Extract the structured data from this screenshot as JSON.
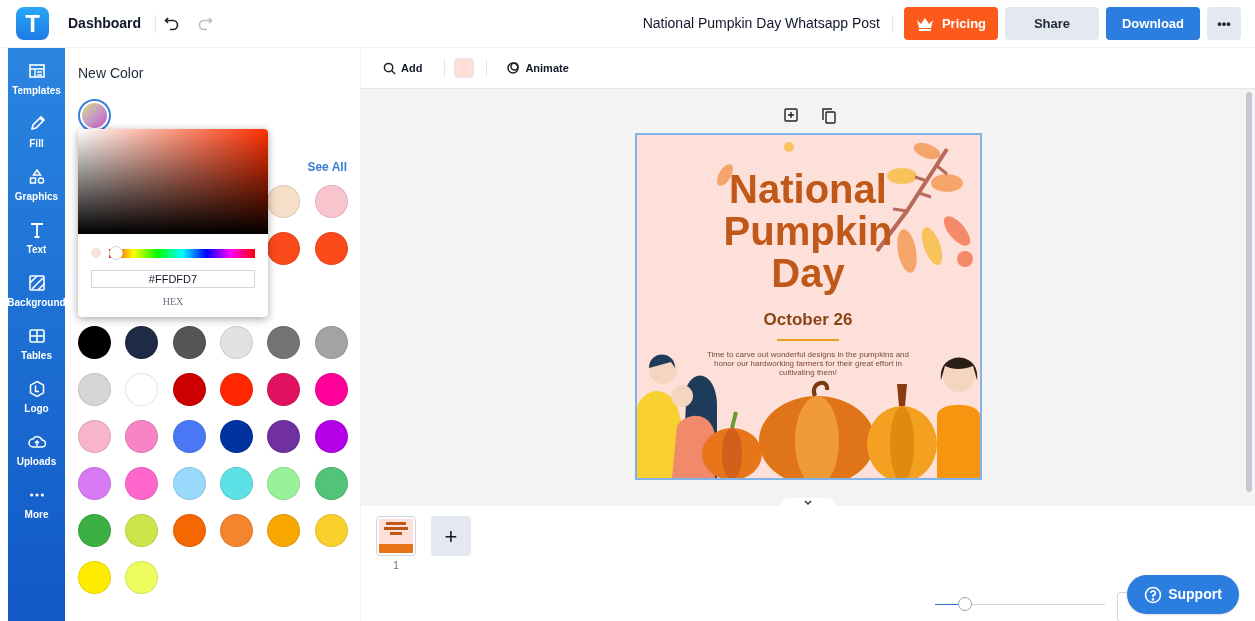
{
  "header": {
    "app_logo": "T",
    "dashboard": "Dashboard",
    "document_title": "National Pumpkin Day Whatsapp Post",
    "buttons": [
      {
        "kind": "pricing",
        "label": "Pricing"
      },
      {
        "kind": "share",
        "label": "Share"
      },
      {
        "kind": "download",
        "label": "Download"
      },
      {
        "kind": "more",
        "label": "•••"
      }
    ]
  },
  "sidebar": {
    "items": [
      {
        "label": "Templates"
      },
      {
        "label": "Fill"
      },
      {
        "label": "Graphics"
      },
      {
        "label": "Text"
      },
      {
        "label": "Background"
      },
      {
        "label": "Tables"
      },
      {
        "label": "Logo"
      },
      {
        "label": "Uploads"
      },
      {
        "label": "More"
      }
    ]
  },
  "color_panel": {
    "title": "New Color",
    "see_all": "See All",
    "picker": {
      "hex_value": "#FFDFD7",
      "hex_label": "HEX",
      "hue": {
        "level": 0.0
      }
    },
    "recent_colors": [
      {
        "color": "#f5dfc8"
      },
      {
        "color": "#f8c4cd"
      },
      {
        "color": "#fc4a1a"
      },
      {
        "color": "#fc4a1a"
      }
    ],
    "palette": [
      {
        "color": "#000000"
      },
      {
        "color": "#1f2a44"
      },
      {
        "color": "#555555"
      },
      {
        "color": "#e2e2e2"
      },
      {
        "color": "#737373"
      },
      {
        "color": "#a3a3a3"
      },
      {
        "color": "#d6d6d6"
      },
      {
        "color": "#ffffff"
      },
      {
        "color": "#cc0000"
      },
      {
        "color": "#ff2600"
      },
      {
        "color": "#e0115f"
      },
      {
        "color": "#ff0099"
      },
      {
        "color": "#f8b4c8"
      },
      {
        "color": "#f784c4"
      },
      {
        "color": "#4a78f5"
      },
      {
        "color": "#0033a0"
      },
      {
        "color": "#7030a0"
      },
      {
        "color": "#b300e6"
      },
      {
        "color": "#d97af5"
      },
      {
        "color": "#ff66cc"
      },
      {
        "color": "#99d9fb"
      },
      {
        "color": "#5ce1e6"
      },
      {
        "color": "#99f299"
      },
      {
        "color": "#52c478"
      },
      {
        "color": "#3cb043"
      },
      {
        "color": "#cbe64a"
      },
      {
        "color": "#f56700"
      },
      {
        "color": "#f5842e"
      },
      {
        "color": "#f8a600"
      },
      {
        "color": "#fad02c"
      },
      {
        "color": "#ffeb00"
      },
      {
        "color": "#eefc5e"
      }
    ]
  },
  "toolbar": {
    "add": "Add",
    "fill_swatch": {
      "color": "#ffdfd7"
    },
    "animate": "Animate"
  },
  "design": {
    "title_lines": [
      "National",
      "Pumpkin",
      "Day"
    ],
    "date": "October 26",
    "description": "Time to carve out wonderful designs in the pumpkins and honor our hardworking farmers for their great effort in cultivating them!"
  },
  "pages": [
    {
      "number": "1",
      "selected": true
    }
  ],
  "add_page": "+",
  "zoom": {
    "level": 0.15
  },
  "support": "Support"
}
